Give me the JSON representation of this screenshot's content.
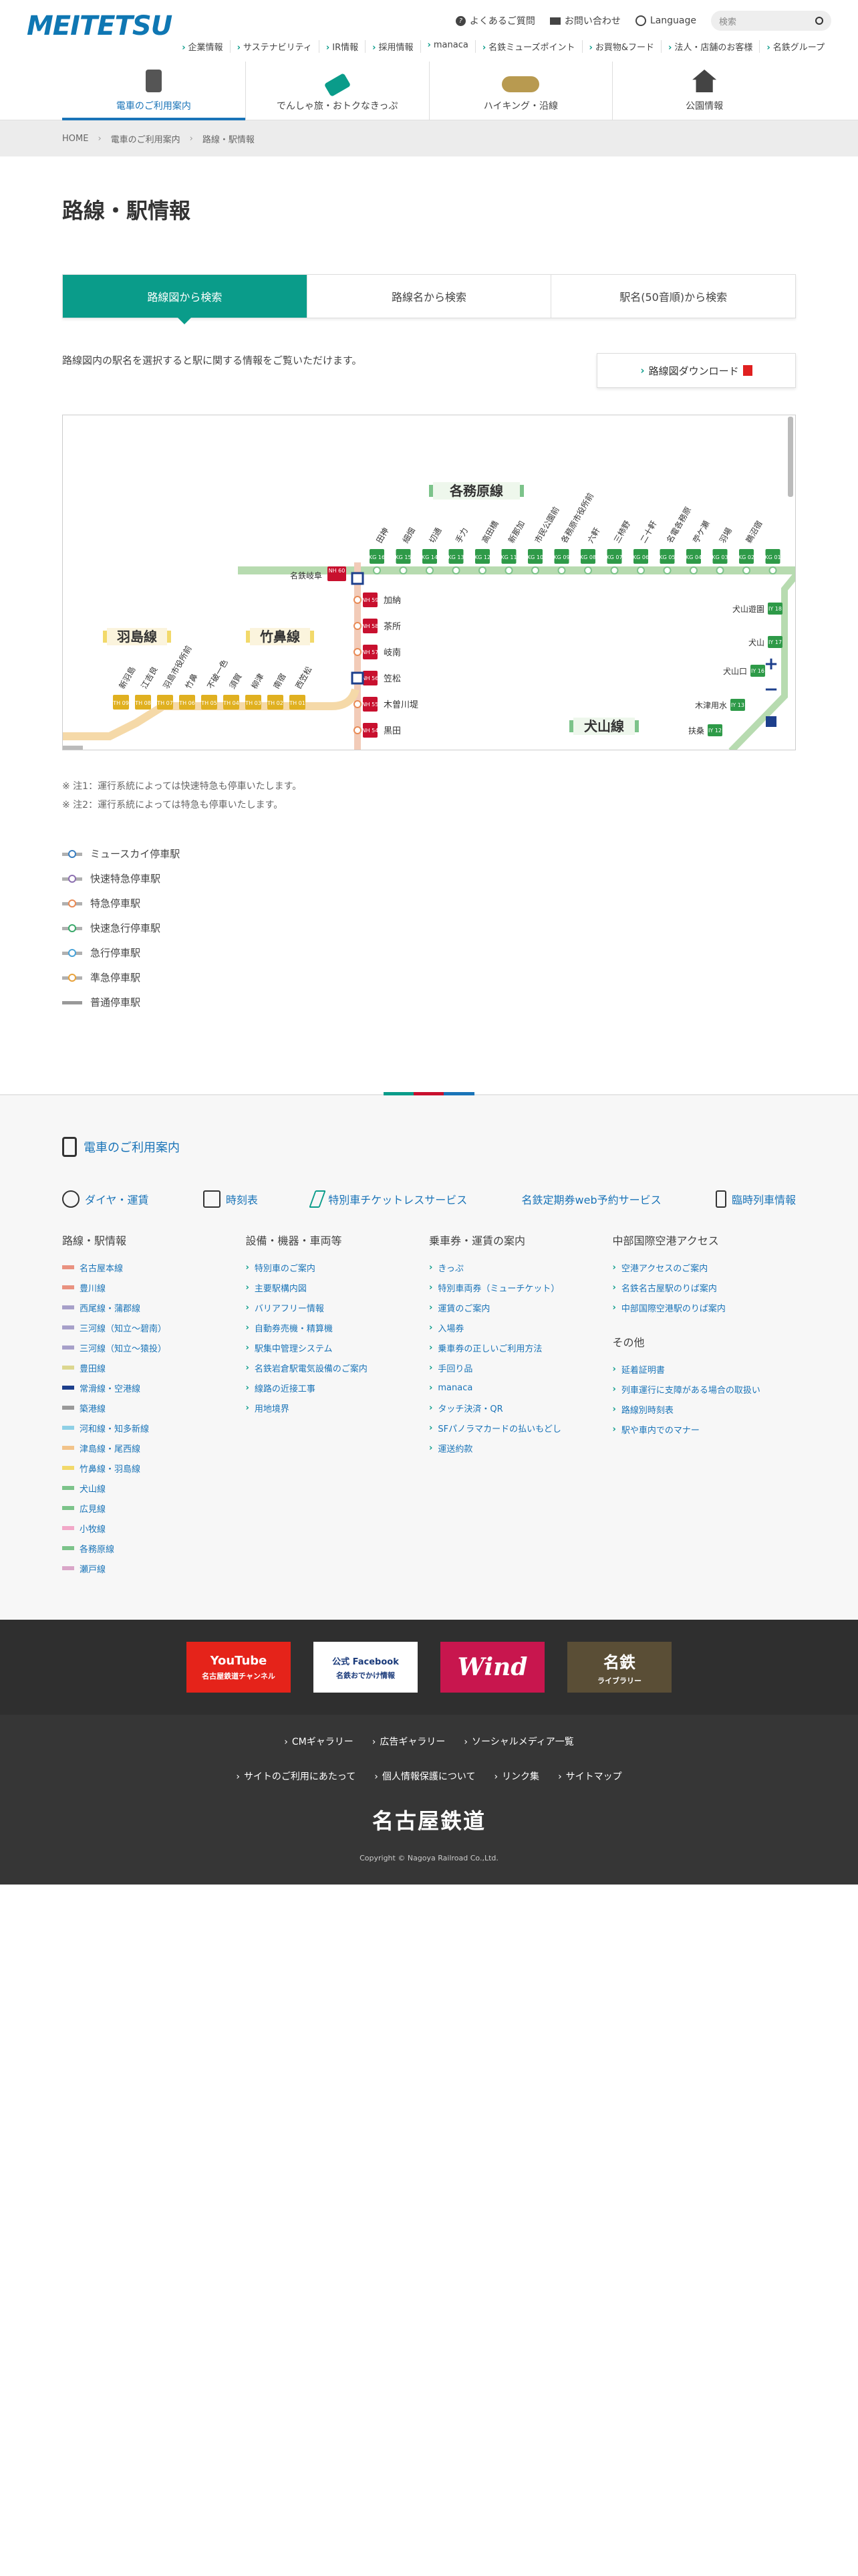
{
  "header": {
    "logo": "MEITETSU",
    "util": [
      "よくあるご質問",
      "お問い合わせ",
      "Language"
    ],
    "search_placeholder": "検索",
    "subnav": [
      "企業情報",
      "サステナビリティ",
      "IR情報",
      "採用情報",
      "manaca",
      "名鉄ミューズポイント",
      "お買物&フード",
      "法人・店舗のお客様",
      "名鉄グループ"
    ],
    "gnav": [
      "電車のご利用案内",
      "でんしゃ旅・おトクなきっぷ",
      "ハイキング・沿線",
      "公園情報"
    ]
  },
  "breadcrumb": [
    "HOME",
    "電車のご利用案内",
    "路線・駅情報"
  ],
  "page_title": "路線・駅情報",
  "tabs": [
    "路線図から検索",
    "路線名から検索",
    "駅名(50音順)から検索"
  ],
  "intro": "路線図内の駅名を選択すると駅に関する情報をご覧いただけます。",
  "download": "路線図ダウンロード",
  "map": {
    "lines": {
      "kakamigahara": "各務原線",
      "hashima": "羽島線",
      "takehana": "竹鼻線",
      "inuyama": "犬山線"
    },
    "kakamigahara_stations": [
      "田神",
      "細畑",
      "切通",
      "手力",
      "高田橋",
      "新那加",
      "市民公園前",
      "各務原市役所前",
      "六軒",
      "三柿野",
      "二十軒",
      "名電各務原",
      "苧ケ瀬",
      "羽場",
      "鵜沼宿"
    ],
    "kakamigahara_codes": [
      "KG 16",
      "KG 15",
      "KG 14",
      "KG 13",
      "KG 12",
      "KG 11",
      "KG 10",
      "KG 09",
      "KG 08",
      "KG 07",
      "KG 06",
      "KG 05",
      "KG 04",
      "KG 03",
      "KG 02",
      "KG 01"
    ],
    "meigifu": {
      "name": "名鉄岐阜",
      "code": "NH 60"
    },
    "main_stations": [
      {
        "name": "加納",
        "code": "NH 59"
      },
      {
        "name": "茶所",
        "code": "NH 58"
      },
      {
        "name": "岐南",
        "code": "NH 57"
      },
      {
        "name": "笠松",
        "code": "NH 56"
      },
      {
        "name": "木曽川堤",
        "code": "NH 55"
      },
      {
        "name": "黒田",
        "code": "NH 54"
      }
    ],
    "takehana_stations": [
      "新羽島",
      "江吉良",
      "羽島市役所前",
      "竹鼻",
      "不破一色",
      "須賀",
      "柳津",
      "南宿",
      "西笠松"
    ],
    "takehana_codes": [
      "TH 09",
      "TH 08",
      "TH 07",
      "TH 06",
      "TH 05",
      "TH 04",
      "TH 03",
      "TH 02",
      "TH 01"
    ],
    "inuyama_stations": [
      {
        "name": "犬山遊園",
        "code": "IY 18"
      },
      {
        "name": "犬山",
        "code": "IY 17"
      },
      {
        "name": "犬山口",
        "code": "IY 16"
      },
      {
        "name": "木津用水",
        "code": "IY 13"
      },
      {
        "name": "扶桑",
        "code": "IY 12"
      }
    ],
    "zoom": [
      "+",
      "−"
    ]
  },
  "notes": [
    "※ 注1：運行系統によっては快速特急も停車いたします。",
    "※ 注2：運行系統によっては特急も停車いたします。"
  ],
  "legend": [
    {
      "label": "ミュースカイ停車駅",
      "color": "#3a7fc1"
    },
    {
      "label": "快速特急停車駅",
      "color": "#8c6fb0"
    },
    {
      "label": "特急停車駅",
      "color": "#e88a55"
    },
    {
      "label": "快速急行停車駅",
      "color": "#3aa96b"
    },
    {
      "label": "急行停車駅",
      "color": "#4aa3d8"
    },
    {
      "label": "準急停車駅",
      "color": "#e8a23b"
    },
    {
      "label": "普通停車駅",
      "color": "#888888"
    }
  ],
  "footer": {
    "head": "電車のご利用案内",
    "quick": [
      "ダイヤ・運賃",
      "時刻表",
      "特別車チケットレスサービス",
      "名鉄定期券web予約サービス",
      "臨時列車情報"
    ],
    "cols": [
      {
        "title": "路線・駅情報",
        "items": [
          {
            "label": "名古屋本線",
            "color": "#e99280"
          },
          {
            "label": "豊川線",
            "color": "#e99280"
          },
          {
            "label": "西尾線・蒲郡線",
            "color": "#a7a0c9"
          },
          {
            "label": "三河線（知立〜碧南）",
            "color": "#a7a0c9"
          },
          {
            "label": "三河線（知立〜猿投）",
            "color": "#a7a0c9"
          },
          {
            "label": "豊田線",
            "color": "#dcd78f"
          },
          {
            "label": "常滑線・空港線",
            "color": "#1d3f8c"
          },
          {
            "label": "築港線",
            "color": "#9a9a9a"
          },
          {
            "label": "河和線・知多新線",
            "color": "#8fd0e6"
          },
          {
            "label": "津島線・尾西線",
            "color": "#f2c38a"
          },
          {
            "label": "竹鼻線・羽島線",
            "color": "#f2d96a"
          },
          {
            "label": "犬山線",
            "color": "#7cc38a"
          },
          {
            "label": "広見線",
            "color": "#7cc38a"
          },
          {
            "label": "小牧線",
            "color": "#f2a8c8"
          },
          {
            "label": "各務原線",
            "color": "#7cc38a"
          },
          {
            "label": "瀬戸線",
            "color": "#d9a6c8"
          }
        ]
      },
      {
        "title": "設備・機器・車両等",
        "items": [
          "特別車のご案内",
          "主要駅構内図",
          "バリアフリー情報",
          "自動券売機・精算機",
          "駅集中管理システム",
          "名鉄岩倉駅電気設備のご案内",
          "線路の近接工事",
          "用地境界"
        ]
      },
      {
        "title": "乗車券・運賃の案内",
        "items": [
          "きっぷ",
          "特別車両券（ミューチケット）",
          "運賃のご案内",
          "入場券",
          "乗車券の正しいご利用方法",
          "手回り品",
          "manaca",
          "タッチ決済・QR",
          "SFパノラマカードの払いもどし",
          "運送約款"
        ]
      },
      {
        "title": "中部国際空港アクセス",
        "items": [
          "空港アクセスのご案内",
          "名鉄名古屋駅のりば案内",
          "中部国際空港駅のりば案内"
        ],
        "title2": "その他",
        "items2": [
          "延着証明書",
          "列車運行に支障がある場合の取扱い",
          "路線別時刻表",
          "駅や車内でのマナー"
        ]
      }
    ]
  },
  "sns": [
    {
      "label": "YouTube",
      "sub": "名古屋鉄道チャンネル",
      "bg": "#e5231a",
      "fg": "#ffffff"
    },
    {
      "label": "公式 Facebook",
      "sub": "名鉄おでかけ情報",
      "bg": "#ffffff",
      "fg": "#1a3a7a"
    },
    {
      "label": "Wind",
      "sub": "",
      "bg": "#c8164e",
      "fg": "#ffffff"
    },
    {
      "label": "名鉄",
      "sub": "ライブラリー",
      "bg": "#5a4e36",
      "fg": "#ffffff"
    }
  ],
  "bottom_links_1": [
    "CMギャラリー",
    "広告ギャラリー",
    "ソーシャルメディア一覧"
  ],
  "bottom_links_2": [
    "サイトのご利用にあたって",
    "個人情報保護について",
    "リンク集",
    "サイトマップ"
  ],
  "corp_name": "名古屋鉄道",
  "copyright": "Copyright © Nagoya Railroad Co.,Ltd."
}
